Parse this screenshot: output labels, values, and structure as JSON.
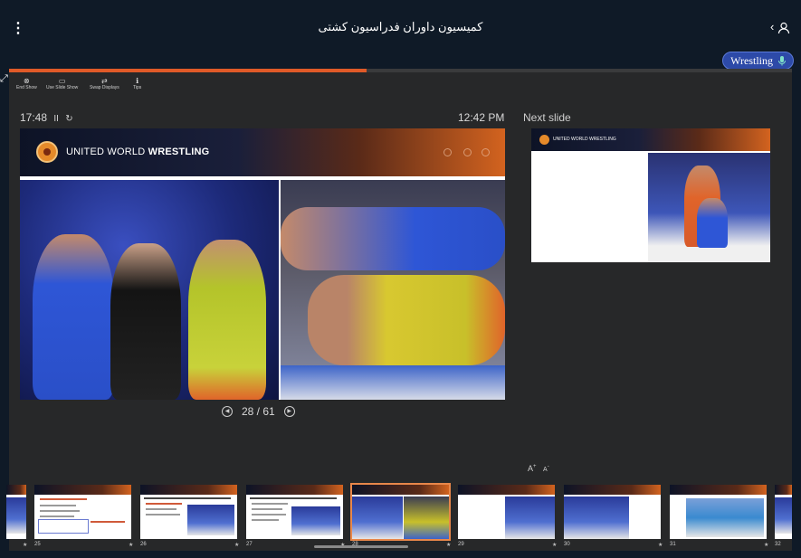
{
  "header": {
    "title": "کمیسیون داوران فدراسیون کشتی",
    "menu_icon": "kebab-menu-icon",
    "people_icon": "person-icon",
    "people_chevron": "‹",
    "pill_label": "Wrestling",
    "pill_icon": "microphone-icon"
  },
  "progress": {
    "fraction": 0.457
  },
  "toolbar": [
    {
      "label": "End Show",
      "icon": "close-circle-icon",
      "glyph": "⊗"
    },
    {
      "label": "Use Slide Show",
      "icon": "slideshow-icon",
      "glyph": "▭"
    },
    {
      "label": "Swap Displays",
      "icon": "swap-icon",
      "glyph": "⇄"
    },
    {
      "label": "Tips",
      "icon": "info-icon",
      "glyph": "ℹ"
    }
  ],
  "timer": {
    "elapsed": "17:48",
    "pause_glyph": "II",
    "reset_glyph": "↻"
  },
  "clock": {
    "time": "12:42 PM"
  },
  "next_label": "Next slide",
  "slide": {
    "brand_regular": "UNITED WORLD ",
    "brand_bold": "WRESTLING",
    "counter": "28 / 61",
    "prev_glyph": "◀",
    "next_glyph": "▶"
  },
  "next_slide": {
    "brand": "UNITED WORLD WRESTLING"
  },
  "font_controls": {
    "larger": "A",
    "smaller": "A"
  },
  "thumbnails": [
    {
      "num": "25",
      "star": "★",
      "selected": false
    },
    {
      "num": "26",
      "star": "★",
      "selected": false
    },
    {
      "num": "27",
      "star": "★",
      "selected": false
    },
    {
      "num": "28",
      "star": "★",
      "selected": true
    },
    {
      "num": "29",
      "star": "★",
      "selected": false
    },
    {
      "num": "30",
      "star": "★",
      "selected": false
    },
    {
      "num": "31",
      "star": "★",
      "selected": false
    },
    {
      "num": "32",
      "star": "★",
      "selected": false
    }
  ],
  "colors": {
    "accent": "#e05a28",
    "pill": "#2d4aa8",
    "background": "#0f1a27",
    "stage": "#272829"
  }
}
